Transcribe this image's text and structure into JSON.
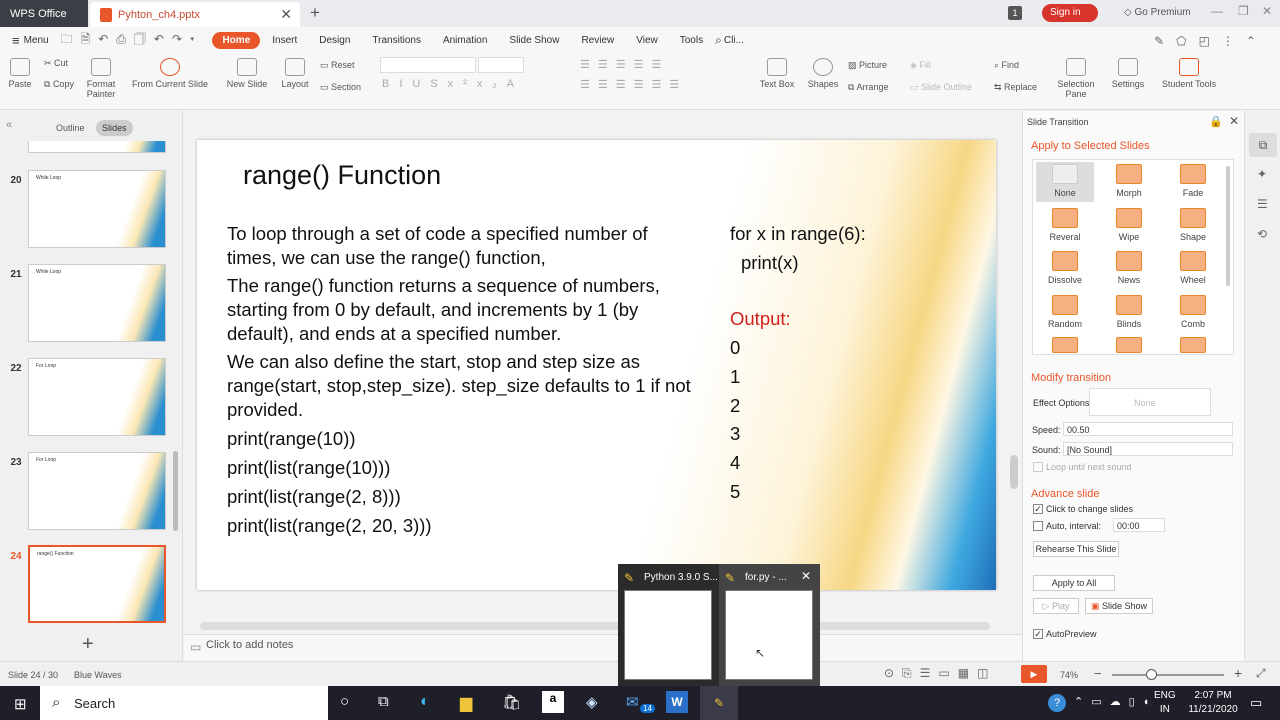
{
  "app": {
    "name": "WPS Office",
    "doc_tab": "Pyhton_ch4.pptx",
    "sign_in": "Sign in",
    "go_premium": "Go Premium",
    "badge": "1"
  },
  "menu": {
    "menu_label": "Menu",
    "tabs": [
      "Home",
      "Insert",
      "Design",
      "Transitions",
      "Animation",
      "Slide Show",
      "Review",
      "View",
      "Tools",
      "Cli..."
    ]
  },
  "ribbon": {
    "paste": "Paste",
    "cut": "Cut",
    "copy": "Copy",
    "format_painter": "Format Painter",
    "from_current": "From Current Slide",
    "new_slide": "New Slide",
    "layout": "Layout",
    "reset": "Reset",
    "section": "Section",
    "picture": "Picture",
    "fill": "Fill",
    "arrange": "Arrange",
    "slide_outline": "Slide Outline",
    "text_box": "Text Box",
    "shapes": "Shapes",
    "find": "Find",
    "replace": "Replace",
    "selection_pane": "Selection Pane",
    "settings": "Settings",
    "student_tools": "Student Tools"
  },
  "leftpanel": {
    "outline": "Outline",
    "slides": "Slides",
    "thumbs": [
      {
        "num": "20",
        "title": "While Loop"
      },
      {
        "num": "21",
        "title": "While Loop"
      },
      {
        "num": "22",
        "title": "For Loop"
      },
      {
        "num": "23",
        "title": "For Loop"
      },
      {
        "num": "24",
        "title": "range() Function"
      }
    ],
    "add": "+"
  },
  "slide": {
    "title": "range() Function",
    "p1": "To loop through a set of code a specified number of times, we can use the range() function,",
    "p2": "The range() function returns a sequence of numbers, starting from 0 by default, and increments by 1 (by default), and ends at a specified number.",
    "p3": "We can also define the start, stop and step size as range(start, stop,step_size). step_size defaults to 1 if not provided.",
    "code1": "print(range(10))",
    "code2": "print(list(range(10)))",
    "code3": "print(list(range(2, 8)))",
    "code4": "print(list(range(2, 20, 3)))",
    "for_line": "for x in range(6):",
    "print_line": "print(x)",
    "output_label": "Output:",
    "outputs": [
      "0",
      "1",
      "2",
      "3",
      "4",
      "5"
    ],
    "output_color": "#d0211c"
  },
  "notes": {
    "placeholder": "Click to add notes"
  },
  "rightpanel": {
    "title": "Slide Transition",
    "apply_selected": "Apply to Selected Slides",
    "transitions": [
      "None",
      "Morph",
      "Fade",
      "Reveral",
      "Wipe",
      "Shape",
      "Dissolve",
      "News",
      "Wheel",
      "Random",
      "Blinds",
      "Comb"
    ],
    "modify": "Modify transition",
    "effect_options": "Effect Options:",
    "effect_value": "None",
    "speed_label": "Speed:",
    "speed_value": "00.50",
    "sound_label": "Sound:",
    "sound_value": "[No Sound]",
    "loop": "Loop until next sound",
    "advance": "Advance slide",
    "click_change": "Click to change slides",
    "auto_interval": "Auto, interval:",
    "interval_value": "00:00",
    "rehearse": "Rehearse This Slide",
    "apply_all": "Apply to All",
    "play": "Play",
    "slide_show": "Slide Show",
    "autopreview": "AutoPreview",
    "accent": "#e8562a"
  },
  "status": {
    "slide": "Slide 24 / 30",
    "theme": "Blue Waves",
    "zoom": "74%"
  },
  "taskbar": {
    "search": "Search",
    "lang1": "ENG",
    "lang2": "IN",
    "time": "2:07 PM",
    "date": "11/21/2020",
    "mail_badge": "14",
    "popup1": "Python 3.9.0 S...",
    "popup2": "for.py - ..."
  }
}
